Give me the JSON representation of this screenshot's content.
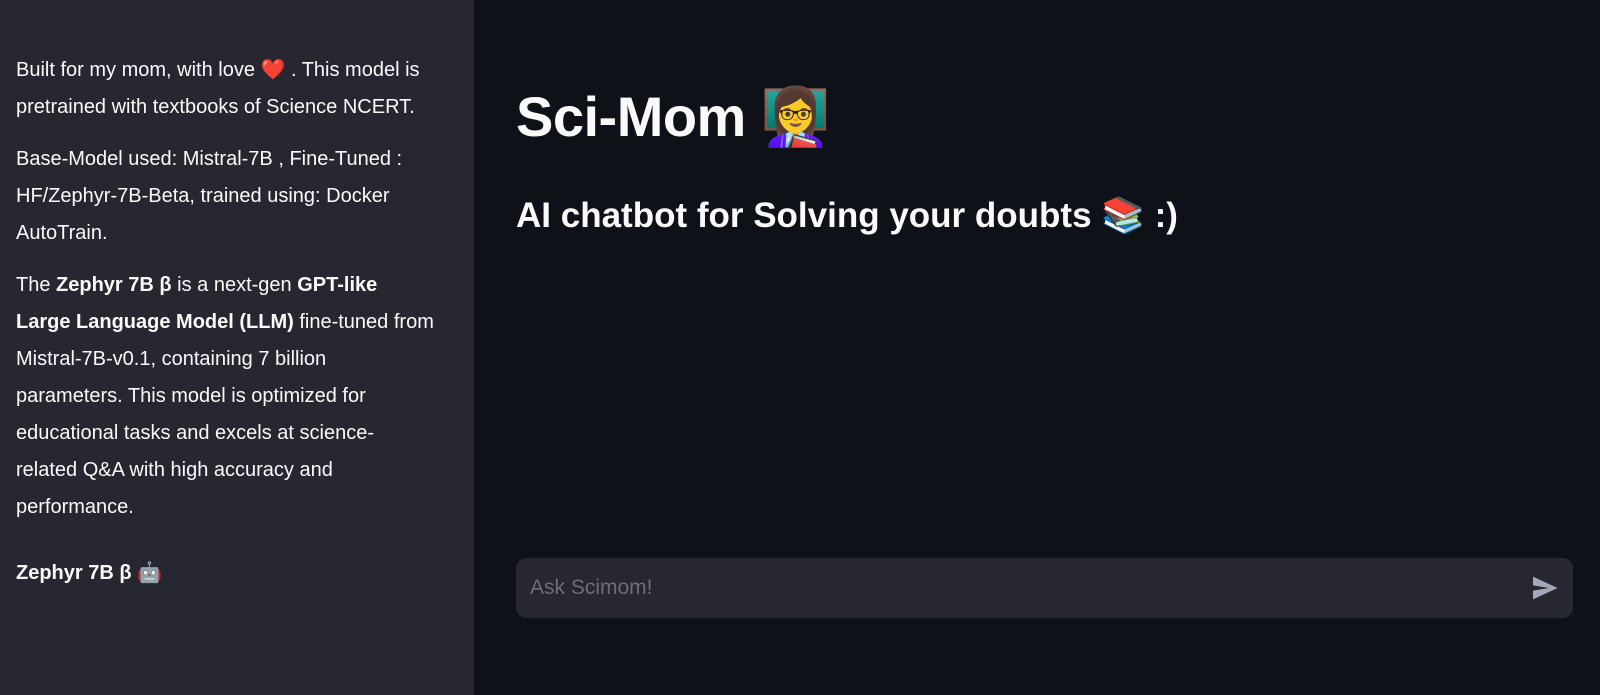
{
  "sidebar": {
    "intro": "Built for my mom, with love ❤️ . This model is pretrained with textbooks of Science NCERT.",
    "base_model": "Base-Model used: Mistral-7B , Fine-Tuned : HF/Zephyr-7B-Beta, trained using: Docker AutoTrain.",
    "desc": {
      "t1": "The ",
      "b1": "Zephyr 7B β",
      "t2": " is a next-gen ",
      "b2": "GPT-like Large Language Model (LLM)",
      "t3": " fine-tuned from Mistral-7B-v0.1, containing 7 billion parameters. This model is optimized for educational tasks and excels at science-related Q&A with high accuracy and performance."
    },
    "model_title": "Zephyr 7B β",
    "model_emoji": "🤖"
  },
  "main": {
    "title": "Sci-Mom",
    "title_emoji": "👩‍🏫",
    "subtitle": "AI chatbot for Solving your doubts",
    "subtitle_emoji": "📚",
    "subtitle_suffix": ":)"
  },
  "chat_input": {
    "placeholder": "Ask Scimom!",
    "value": "",
    "send_icon": "send-arrow-icon"
  },
  "colors": {
    "sidebar_bg": "#262730",
    "main_bg": "#0e1117",
    "text": "#fafafa",
    "input_bg": "#262730",
    "placeholder": "#6c6e78"
  }
}
